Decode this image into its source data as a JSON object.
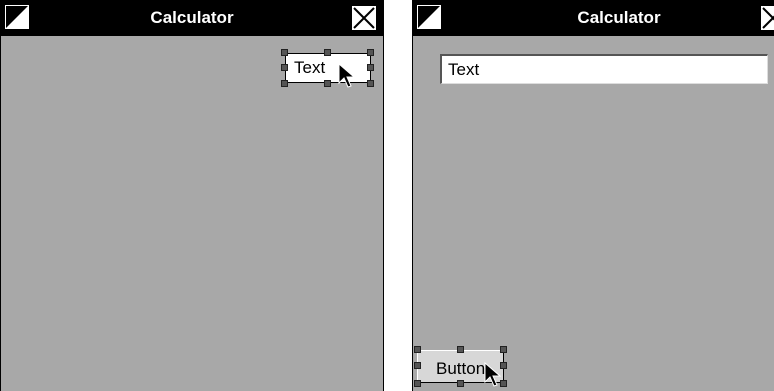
{
  "left_window": {
    "title": "Calculator",
    "text_field_label": "Text"
  },
  "right_window": {
    "title": "Calculator",
    "text_field_label": "Text",
    "button_label": "Button"
  },
  "icons": [
    "window-menu-icon",
    "close-icon",
    "cursor-arrow-icon",
    "resize-handle-icon"
  ],
  "colors": {
    "titlebar": "#000000",
    "window_bg": "#a8a8a8",
    "field_bg": "#ffffff",
    "handle": "#555555"
  }
}
